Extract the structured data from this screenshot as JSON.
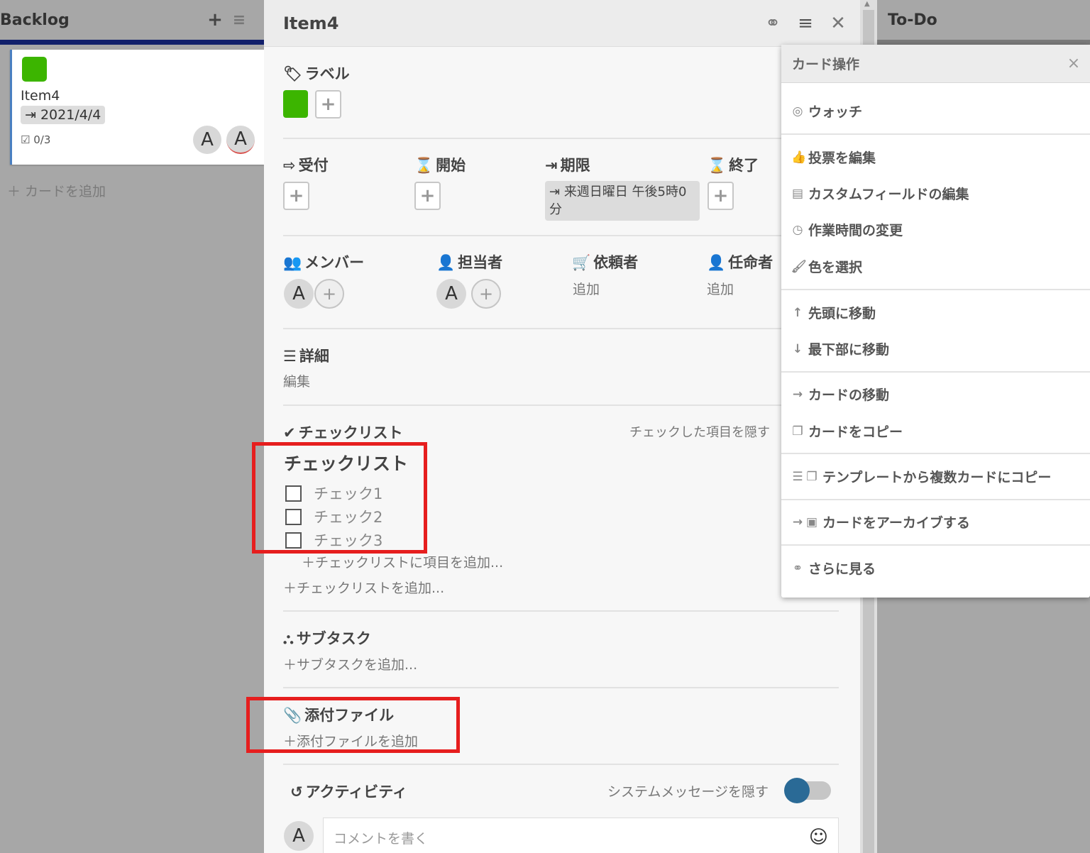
{
  "backlog": {
    "title": "Backlog",
    "add_icon": "+",
    "menu_icon": "≡",
    "card": {
      "title": "Item4",
      "date": "2021/4/4",
      "checklist": "0/3",
      "avatar1": "A",
      "avatar2": "A"
    },
    "add_card": "カードを追加"
  },
  "todo": {
    "title": "To-Do"
  },
  "detail": {
    "title": "Item4",
    "labels_title": "ラベル",
    "received_title": "受付",
    "start_title": "開始",
    "due_title": "期限",
    "end_title": "終了",
    "due_value": "来週日曜日 午後5時0分",
    "members_title": "メンバー",
    "assignee_title": "担当者",
    "requester_title": "依頼者",
    "assigner_title": "任命者",
    "requester_add": "追加",
    "assigner_add": "追加",
    "member_avatar": "A",
    "assignee_avatar": "A",
    "description_title": "詳細",
    "description_edit": "編集",
    "checklists_title": "チェックリスト",
    "hide_checked": "チェックした項目を隠す",
    "checklist_name": "チェックリスト",
    "checklist_items": [
      "チェック1",
      "チェック2",
      "チェック3"
    ],
    "add_checklist_item": "チェックリストに項目を追加...",
    "add_checklist": "チェックリストを追加...",
    "subtasks_title": "サブタスク",
    "add_subtask": "サブタスクを追加...",
    "attachments_title": "添付ファイル",
    "add_attachment": "添付ファイルを追加",
    "activity_title": "アクティビティ",
    "hide_system_messages": "システムメッセージを隠す",
    "comment_avatar": "A",
    "comment_placeholder": "コメントを書く"
  },
  "card_actions": {
    "title": "カード操作",
    "items": [
      "ウォッチ",
      "投票を編集",
      "カスタムフィールドの編集",
      "作業時間の変更",
      "色を選択",
      "先頭に移動",
      "最下部に移動",
      "カードの移動",
      "カードをコピー",
      "テンプレートから複数カードにコピー",
      "カードをアーカイブする",
      "さらに見る"
    ]
  },
  "colors": {
    "label_green": "#3cb500",
    "highlight_red": "#e61e1e",
    "backlog_bar": "#12206b",
    "toggle_knob": "#2a6a96"
  }
}
